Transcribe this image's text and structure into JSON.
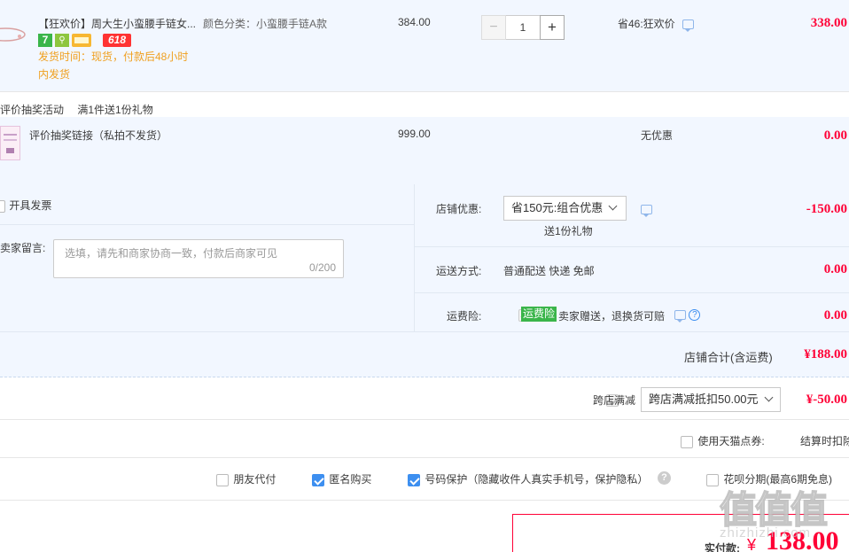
{
  "item1": {
    "title": "【狂欢价】周大生小蛮腰手链女...",
    "sku": "颜色分类：小蛮腰手链A款",
    "badges": [
      "7",
      "618"
    ],
    "ship_note_1": "发货时间：现货，付款后48小时",
    "ship_note_2": "内发货",
    "price": "384.00",
    "qty": "1",
    "minus": "−",
    "plus": "+",
    "promo": "省46:狂欢价",
    "total": "338.00"
  },
  "gift_group": {
    "label1": "评价抽奖活动",
    "label2": "满1件送1份礼物"
  },
  "item2": {
    "title": "评价抽奖链接（私拍不发货）",
    "price": "999.00",
    "promo": "无优惠",
    "total": "0.00"
  },
  "order_opts": {
    "invoice": "开具发票",
    "message_label": "卖家留言:",
    "message_placeholder": "选填，请先和商家协商一致，付款后商家可见",
    "message_count": "0/200",
    "shop_discount_label": "店铺优惠:",
    "shop_discount_value": "省150元:组合优惠",
    "shop_discount_gift": "送1份礼物",
    "shop_discount_amount": "-150.00",
    "shipping_label": "运送方式:",
    "shipping_value": "普通配送 快递 免邮",
    "shipping_amount": "0.00",
    "insurance_label": "运费险:",
    "insurance_tag": "运费险",
    "insurance_text": "卖家赠送，退换货可赔",
    "insurance_amount": "0.00",
    "shop_total_label": "店铺合计(含运费)",
    "shop_total": "¥188.00"
  },
  "cross_store": {
    "label": "跨店满减",
    "select": "跨店满减抵扣50.00元",
    "amount": "¥-50.00"
  },
  "tmall_points": {
    "label": "使用天猫点券:",
    "note": "结算时扣除"
  },
  "options": {
    "friend_pay": "朋友代付",
    "anonymous": "匿名购买",
    "number_protect": "号码保护（隐藏收件人真实手机号，保护隐私）",
    "huabei": "花呗分期(最高6期免息)"
  },
  "pay": {
    "label": "实付款:",
    "currency": "¥",
    "amount": "138.00"
  },
  "watermark": {
    "text": "值值值",
    "domain": "zhizhizhi.com"
  },
  "colors": {
    "accent_red": "#ff0036",
    "accent_blue": "#3d8ff0",
    "row_bg": "#f2f7ff",
    "orange_note": "#f0a020"
  }
}
